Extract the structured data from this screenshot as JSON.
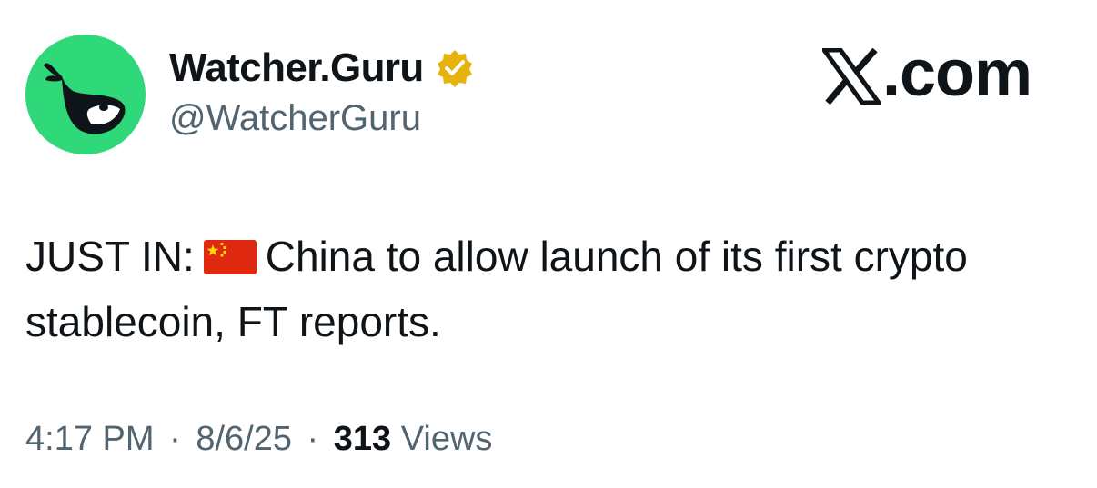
{
  "author": {
    "display_name": "Watcher.Guru",
    "handle": "@WatcherGuru",
    "verified": true,
    "avatar_icon": "whale-logo-icon",
    "avatar_bg": "#2fd879",
    "verified_color": "#e8b20e"
  },
  "brand": {
    "label": ".com",
    "icon": "x-logo-icon"
  },
  "tweet": {
    "prefix": "JUST IN:",
    "flag_icon": "china-flag-icon",
    "body": "China to allow launch of its first crypto stablecoin, FT reports."
  },
  "meta": {
    "time": "4:17 PM",
    "separator": "·",
    "date": "8/6/25",
    "views_count": "313",
    "views_label": "Views"
  },
  "colors": {
    "text": "#0f1419",
    "secondary": "#536471"
  }
}
